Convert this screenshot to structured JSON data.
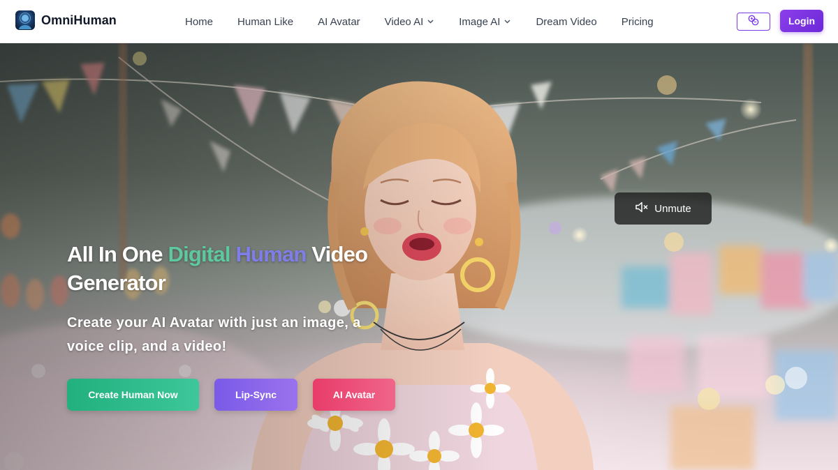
{
  "brand": {
    "name": "OmniHuman",
    "logo_icon": "avatar-logo-icon"
  },
  "nav": {
    "items": [
      {
        "label": "Home",
        "has_dropdown": false
      },
      {
        "label": "Human Like",
        "has_dropdown": false
      },
      {
        "label": "AI Avatar",
        "has_dropdown": false
      },
      {
        "label": "Video AI",
        "has_dropdown": true
      },
      {
        "label": "Image AI",
        "has_dropdown": true
      },
      {
        "label": "Dream Video",
        "has_dropdown": false
      },
      {
        "label": "Pricing",
        "has_dropdown": false
      }
    ],
    "language_icon": "language-translate-icon",
    "login_label": "Login"
  },
  "hero": {
    "unmute_label": "Unmute",
    "unmute_icon": "speaker-muted-icon",
    "headline": {
      "part1": "All In One ",
      "highlight1": "Digital",
      "space": " ",
      "highlight2": "Human",
      "part2": " Video Generator"
    },
    "subheadline": "Create your AI Avatar with just an image, a voice clip, and a video!",
    "buttons": {
      "create": "Create Human Now",
      "lipsync": "Lip-Sync",
      "avatar": "AI Avatar"
    }
  },
  "colors": {
    "accent_purple": "#7c3aed",
    "highlight_green": "#5ec9a0",
    "highlight_purple": "#7f7ee8",
    "cta_green": "#21b07e",
    "cta_purple": "#7a5ae8",
    "cta_pink": "#e83c6a"
  }
}
